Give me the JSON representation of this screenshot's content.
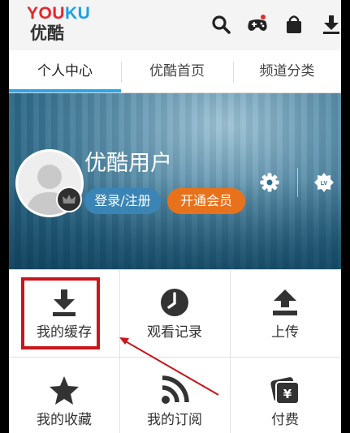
{
  "header": {
    "logo_you": "YOU",
    "logo_ku": "KU",
    "logo_sub": "优酷",
    "icons": [
      "search-icon",
      "game-controller-icon",
      "shopping-bag-icon",
      "download-icon"
    ]
  },
  "tabs": [
    {
      "label": "个人中心",
      "active": true
    },
    {
      "label": "优酷首页",
      "active": false
    },
    {
      "label": "频道分类",
      "active": false
    }
  ],
  "profile": {
    "username": "优酷用户",
    "login_label": "登录/注册",
    "vip_label": "开通会员",
    "icons": [
      "settings-gear-icon",
      "level-badge-icon"
    ],
    "level_text": "LV"
  },
  "menu": [
    {
      "label": "我的缓存",
      "icon": "download-icon"
    },
    {
      "label": "观看记录",
      "icon": "clock-icon"
    },
    {
      "label": "上传",
      "icon": "upload-icon"
    },
    {
      "label": "我的收藏",
      "icon": "star-icon"
    },
    {
      "label": "我的订阅",
      "icon": "rss-icon"
    },
    {
      "label": "付费",
      "icon": "wallet-icon"
    }
  ],
  "annotation": {
    "highlighted_item": "我的缓存",
    "colors": {
      "highlight": "#c8161c",
      "arrow": "#c8161c"
    }
  },
  "colors": {
    "accent": "#2aa7e8",
    "vip": "#e8721c",
    "login": "#3a85b6"
  }
}
